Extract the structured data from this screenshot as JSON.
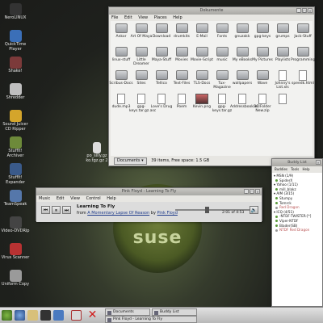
{
  "desktop": {
    "icons": [
      {
        "label": "NeroLINUX",
        "color": "#333333"
      },
      {
        "label": "QuickTime Player",
        "color": "#3b6fb8"
      },
      {
        "label": "Shake!",
        "color": "#7c3a3a"
      },
      {
        "label": "Shredder",
        "color": "#bfbfbf"
      },
      {
        "label": "Sound Juicer CD Ripper",
        "color": "#d4a52b"
      },
      {
        "label": "StuffIt! Archiver",
        "color": "#6d8a3a"
      },
      {
        "label": "StuffIt! Expander",
        "color": "#3a5a8a"
      },
      {
        "label": "TeamSpeak",
        "color": "#5577aa"
      },
      {
        "label": "Video-DVDRip",
        "color": "#444444"
      },
      {
        "label": "Virus Scanner",
        "color": "#b83232"
      },
      {
        "label": "Uniform Copy",
        "color": "#9a9a9a"
      }
    ],
    "floating_item": "po_silly.gz ko.tgz.gz 2",
    "logo_text": "suse"
  },
  "file_manager": {
    "title": "Dokumente",
    "menu": [
      "File",
      "Edit",
      "View",
      "Places",
      "Help"
    ],
    "items": [
      {
        "label": "Ankor",
        "kind": "folder"
      },
      {
        "label": "Art Of Maya",
        "kind": "folder"
      },
      {
        "label": "Download",
        "kind": "folder"
      },
      {
        "label": "drumkits",
        "kind": "folder"
      },
      {
        "label": "E-Mail",
        "kind": "folder"
      },
      {
        "label": "Fonts",
        "kind": "folder"
      },
      {
        "label": "gnuzakk",
        "kind": "folder"
      },
      {
        "label": "gpg-keys",
        "kind": "folder"
      },
      {
        "label": "grumps",
        "kind": "folder"
      },
      {
        "label": "Jack-Stuff",
        "kind": "folder"
      },
      {
        "label": "linux-stuff",
        "kind": "folder"
      },
      {
        "label": "Little Dreamer",
        "kind": "folder"
      },
      {
        "label": "Maya-Stuff",
        "kind": "folder"
      },
      {
        "label": "Movies",
        "kind": "folder"
      },
      {
        "label": "Movie-Script",
        "kind": "folder"
      },
      {
        "label": "music",
        "kind": "folder"
      },
      {
        "label": "My eBooks",
        "kind": "folder"
      },
      {
        "label": "My Pictures",
        "kind": "folder"
      },
      {
        "label": "Playlists",
        "kind": "folder"
      },
      {
        "label": "Programming",
        "kind": "folder"
      },
      {
        "label": "Scribus-Docs",
        "kind": "folder"
      },
      {
        "label": "Sites",
        "kind": "folder"
      },
      {
        "label": "Tellico",
        "kind": "folder"
      },
      {
        "label": "Text-Files",
        "kind": "folder"
      },
      {
        "label": "TLS-Docs",
        "kind": "folder"
      },
      {
        "label": "Tux-Magazine",
        "kind": "folder"
      },
      {
        "label": "wallpapers",
        "kind": "folder"
      },
      {
        "label": "Wave",
        "kind": "folder"
      },
      {
        "label": "Johnny's List.xls",
        "kind": "doc"
      },
      {
        "label": "speedk.html",
        "kind": "doc"
      },
      {
        "label": "dude.mp3",
        "kind": "doc"
      },
      {
        "label": "gpg-keys.tar.gz.asc",
        "kind": "doc"
      },
      {
        "label": "Love's Drug",
        "kind": "doc"
      },
      {
        "label": "Poem",
        "kind": "doc"
      },
      {
        "label": "Kevin.png",
        "kind": "image"
      },
      {
        "label": "gpg-keys.tar.gz",
        "kind": "doc"
      },
      {
        "label": "Addressbook.xsl",
        "kind": "doc"
      },
      {
        "label": "BC Folder New.zip",
        "kind": "doc"
      },
      {
        "label": "",
        "kind": "doc"
      }
    ],
    "location": "Documents",
    "status": "39 items, Free space: 1.5 GB"
  },
  "player": {
    "title": "Pink Floyd - Learning To Fly",
    "menu": [
      "Music",
      "Edit",
      "View",
      "Control",
      "Help"
    ],
    "track": "Learning To Fly",
    "from_word": "from",
    "album": "A Momentary Lapse Of Reason",
    "by_word": "by",
    "artist": "Pink Floyd",
    "time": "2:01 of 4:53",
    "progress": 0.41
  },
  "buddy_list": {
    "title": "Buddy List",
    "menu": [
      "Buddies",
      "Tools",
      "Help"
    ],
    "entries": [
      {
        "text": "MSN (1/9)",
        "type": "group"
      },
      {
        "text": "SpiderX",
        "type": "online"
      },
      {
        "text": "Yahoo (1/11)",
        "type": "group"
      },
      {
        "text": "mill_blakz",
        "type": "online"
      },
      {
        "text": "AIM (3/15)",
        "type": "group"
      },
      {
        "text": "Stumpy",
        "type": "online"
      },
      {
        "text": "Tomrck",
        "type": "online"
      },
      {
        "text": "Red Dragon",
        "type": "offline"
      },
      {
        "text": "ICQ (4/51)",
        "type": "group"
      },
      {
        "text": "-NTDF-TWISTER-[*]",
        "type": "online"
      },
      {
        "text": "Viper-NTDF",
        "type": "online"
      },
      {
        "text": "Blader(SB)",
        "type": "online"
      },
      {
        "text": "NTDF Red Dragon",
        "type": "offline"
      }
    ]
  },
  "taskbar": {
    "tasks": [
      {
        "label": "Documents"
      },
      {
        "label": "Buddy List"
      },
      {
        "label": "Pink Floyd - Learning To Fly"
      }
    ]
  }
}
